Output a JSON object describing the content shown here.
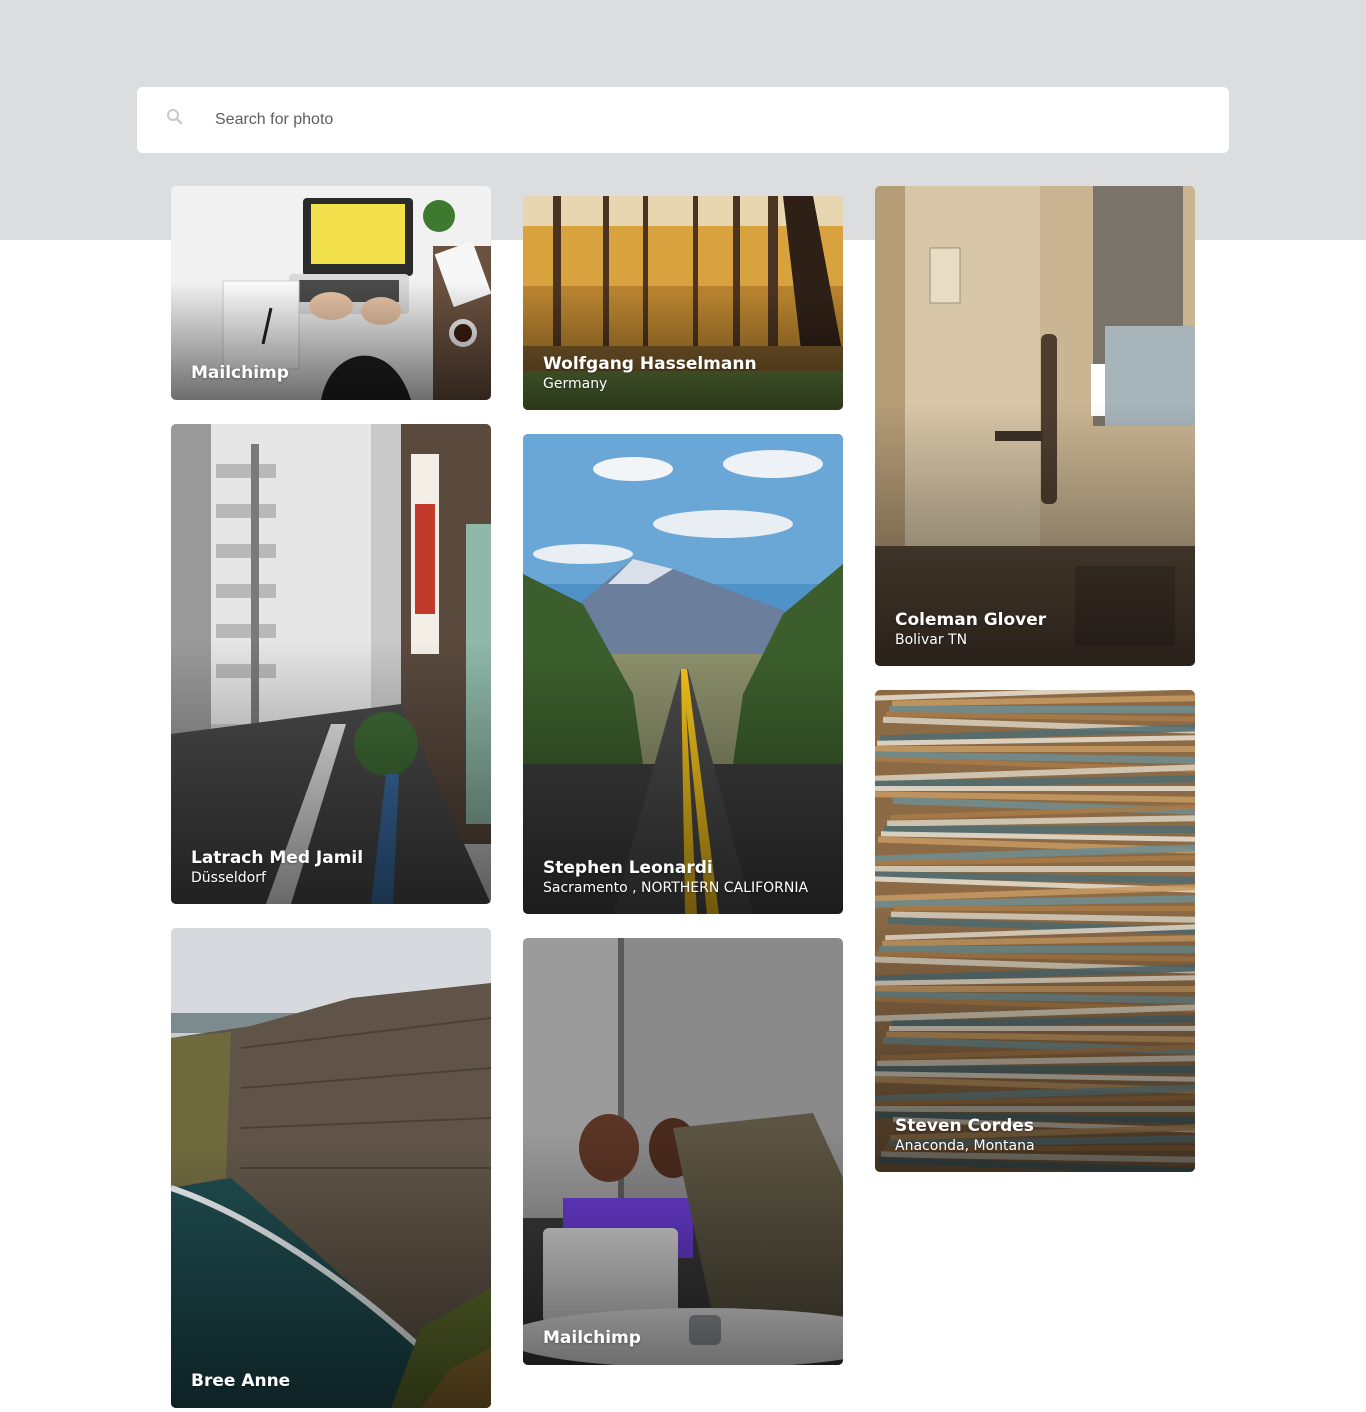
{
  "search": {
    "placeholder": "Search for photo",
    "value": "",
    "icon": "search-icon"
  },
  "photos": [
    {
      "id": "mailchimp-desk",
      "author": "Mailchimp",
      "location": ""
    },
    {
      "id": "forest",
      "author": "Wolfgang Hasselmann",
      "location": "Germany"
    },
    {
      "id": "door",
      "author": "Coleman Glover",
      "location": "Bolivar TN"
    },
    {
      "id": "street",
      "author": "Latrach Med Jamil",
      "location": "Düsseldorf"
    },
    {
      "id": "road",
      "author": "Stephen Leonardi",
      "location": "Sacramento , NORTHERN CALIFORNIA"
    },
    {
      "id": "papers",
      "author": "Steven Cordes",
      "location": "Anaconda, Montana"
    },
    {
      "id": "cliffs",
      "author": "Bree Anne",
      "location": ""
    },
    {
      "id": "couple",
      "author": "Mailchimp",
      "location": ""
    }
  ],
  "colors": {
    "hero_background": "#dcdddf",
    "page_background": "#ffffff",
    "caption_text": "#ffffff"
  }
}
